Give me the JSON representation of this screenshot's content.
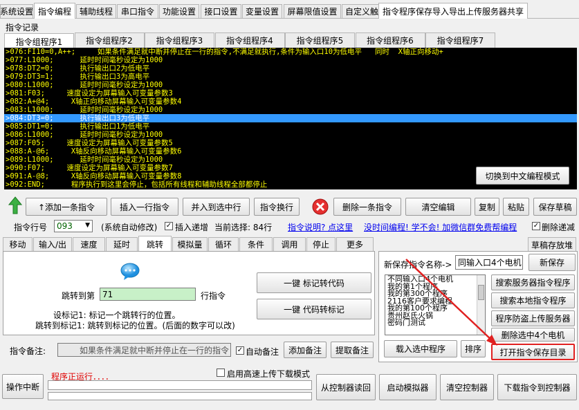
{
  "top_tabs": [
    "系统设置",
    "指令编程",
    "辅助线程",
    "串口指令",
    "功能设置",
    "接口设置",
    "变量设置",
    "屏幕限值设置",
    "自定义触控屏界面",
    "催款设置",
    "版本更新"
  ],
  "section_title": "指令记录",
  "group_tabs": [
    "指令组程序1",
    "指令组程序2",
    "指令组程序3",
    "指令组程序4",
    "指令组程序5",
    "指令组程序6",
    "指令组程序7"
  ],
  "code_lines": [
    ">076:FI10=0,A++;     如果条件满足就中断并停止在一行的指令,不满足就执行,条件为输入口10为低电平   同时  X轴正向移动+",
    ">077:L1000;      延时时间毫秒设定为1000",
    ">078:DT2=0;      执行输出口2为低电平",
    ">079:DT3=1;      执行输出口3为高电平",
    ">080:L1000;      延时时间毫秒设定为1000",
    ">081:F03;     速度设定为屏幕输入可变量参数3",
    ">082:A+@4;     X轴正向移动屏幕输入可变量参数4",
    ">083:L1000;      延时时间毫秒设定为1000",
    ">084:DT3=0;      执行输出口3为低电平",
    ">085:DT1=0;      执行输出口1为低电平",
    ">086:L1000;      延时时间毫秒设定为1000",
    ">087:F05;     速度设定为屏幕输入可变量参数5",
    ">088:A-@6;     X轴反向移动屏幕输入可变量参数6",
    ">089:L1000;      延时时间毫秒设定为1000",
    ">090:F07;     速度设定为屏幕输入可变量参数7",
    ">091:A-@8;     X轴反向移动屏幕输入可变量参数8",
    ">092:END;      程序执行到这里会停止，包括所有线程和辅助线程全部都停止"
  ],
  "selected_line_index": 8,
  "switch_button": "切换到中文编程模式",
  "toolbar": {
    "add_one": "↑添加一条指令",
    "insert_one": "插入一行指令",
    "merge_into": "并入到选中行",
    "replace": "指令换行",
    "delete_one": "删除一条指令",
    "clear_edit": "清空编辑",
    "copy": "复制",
    "paste": "粘贴",
    "save_draft": "保存草稿"
  },
  "status_row": {
    "line_label": "指令行号",
    "line_value": "093",
    "auto_modify": "(系统自动修改)",
    "insert_increment": "插入递增",
    "current_selection": "当前选择: 84行",
    "help_link": "指令说明? 点这里",
    "learn_link": "没时间编程! 学不会! 加微信群免费帮编程",
    "delete_decrement": "删除递减"
  },
  "sub_tabs": [
    "移动",
    "输入/出",
    "速度",
    "延时",
    "跳转",
    "模拟量",
    "循环",
    "条件",
    "调用",
    "停止",
    "更多"
  ],
  "jump_panel": {
    "jump_to_label": "跳转到第",
    "jump_to_value": "71",
    "line_suffix": "行指令",
    "btn_mark_to_code": "一键  标记转代码",
    "btn_code_to_mark": "一键  代码转标记",
    "note1": "设标记1: 标记一个跳转行的位置。",
    "note2": "跳转到标记1: 跳转到标记的位置。(后面的数字可以改)"
  },
  "remark": {
    "label": "指令备注:",
    "value": "如果条件满足就中断并停止在一行的指令",
    "auto_remark": "自动备注",
    "add_remark": "添加备注",
    "extract_remark": "提取备注"
  },
  "right_panel": {
    "tab1": "指令程序保存导入导出上传服务器共享",
    "tab2": "草稿存放堆",
    "new_name_label": "新保存指令名称->",
    "new_name_value": "同输入口4个电机",
    "new_save": "新保存",
    "list_items": [
      "不同输入口4个电机",
      "我的第1个程序",
      "我的第300个程序",
      "2116客户要求编程",
      "我的第100个程序",
      "贵州赵氏火锅",
      "密码门测试"
    ],
    "search_server": "搜索服务器指令程序",
    "search_local": "搜索本地指令程序",
    "anti_theft_upload": "程序防盗上传服务器",
    "delete_selected": "删除选中4个电机",
    "load_selected": "载入选中程序",
    "sort": "排序",
    "open_folder": "打开指令保存目录"
  },
  "bottom": {
    "interrupt": "操作中断",
    "running": "程序正运行．．．．",
    "high_speed": "启用高速上传下载模式",
    "read_from_controller": "从控制器读回",
    "start_simulator": "启动模拟器",
    "clear_controller": "清空控制器",
    "download": "下载指令到控制器"
  },
  "colors": {
    "code_bg": "#000000",
    "code_text": "#ffff00",
    "selection": "#3399ff",
    "running_text": "#e00000",
    "jump_input": "#c8f0c8",
    "arrow": "#e02020"
  }
}
